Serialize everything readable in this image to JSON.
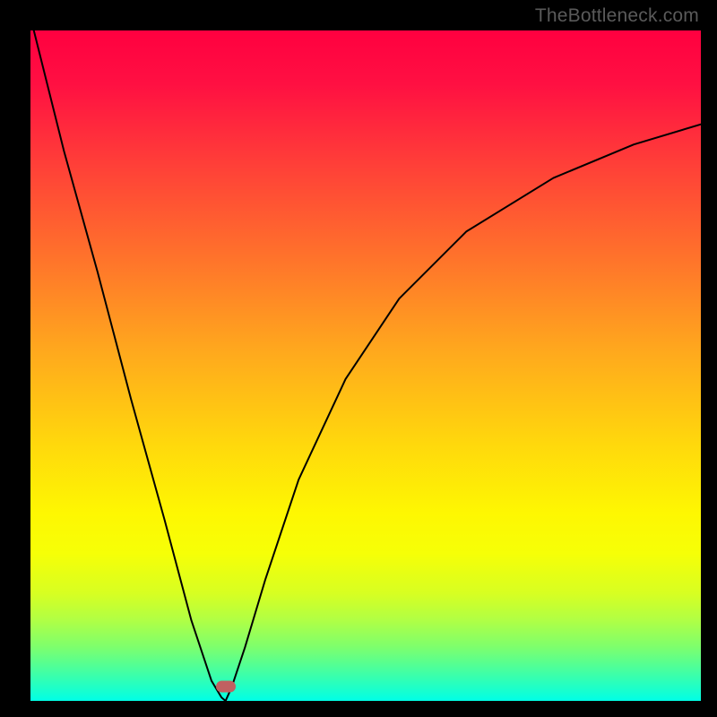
{
  "watermark": "TheBottleneck.com",
  "colors": {
    "frame": "#000000",
    "marker": "#c16061",
    "curve": "#000000"
  },
  "gradient_stops": [
    {
      "offset": 0,
      "color": "#ff0040"
    },
    {
      "offset": 8,
      "color": "#ff1042"
    },
    {
      "offset": 20,
      "color": "#ff3f38"
    },
    {
      "offset": 34,
      "color": "#ff732b"
    },
    {
      "offset": 48,
      "color": "#ffa91d"
    },
    {
      "offset": 62,
      "color": "#ffd90c"
    },
    {
      "offset": 72,
      "color": "#fef702"
    },
    {
      "offset": 78,
      "color": "#f6ff07"
    },
    {
      "offset": 84,
      "color": "#d7ff22"
    },
    {
      "offset": 88,
      "color": "#b0ff45"
    },
    {
      "offset": 92,
      "color": "#7dff6d"
    },
    {
      "offset": 96,
      "color": "#3effa8"
    },
    {
      "offset": 100,
      "color": "#00ffe6"
    }
  ],
  "chart_data": {
    "type": "line",
    "title": "",
    "xlabel": "",
    "ylabel": "",
    "xlim": [
      0,
      100
    ],
    "ylim": [
      0,
      100
    ],
    "grid": false,
    "note": "Bottleneck curve — left branch descends steeply from top-left to global minimum near x≈29, right branch rises concavely toward top-right.",
    "marker": {
      "x_percent": 29.1,
      "y_percent": 97.9
    },
    "series": [
      {
        "name": "left-branch",
        "x": [
          0.5,
          5,
          10,
          15,
          20,
          24,
          27,
          28.5,
          29.1
        ],
        "values": [
          100,
          82,
          64,
          45,
          27,
          12,
          3,
          0.5,
          0.0
        ]
      },
      {
        "name": "right-branch",
        "x": [
          29.1,
          30,
          32,
          35,
          40,
          47,
          55,
          65,
          78,
          90,
          100
        ],
        "values": [
          0.0,
          2,
          8,
          18,
          33,
          48,
          60,
          70,
          78,
          83,
          86
        ]
      }
    ]
  }
}
